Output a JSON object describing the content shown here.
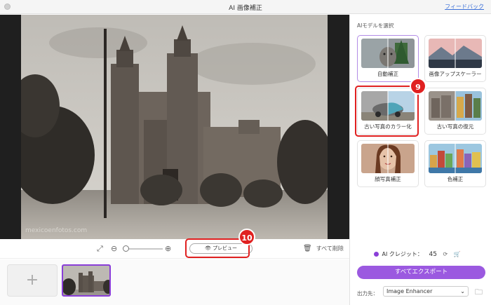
{
  "window": {
    "title": "AI 画像補正",
    "feedback_link": "フィードバック"
  },
  "toolbar": {
    "preview_label": "プレビュー",
    "delete_all_label": "すべて削除",
    "icons": [
      "compare-icon",
      "zoom-out-icon",
      "zoom-in-icon",
      "eye-icon",
      "trash-icon"
    ]
  },
  "photo": {
    "watermark": "mexicoenfotos.com"
  },
  "annotations": {
    "badge_9": "9",
    "badge_10": "10"
  },
  "sidebar": {
    "section_label": "AIモデルを選択",
    "models": [
      {
        "label": "自動補正",
        "selected": true
      },
      {
        "label": "画像アップスケーラー",
        "selected": false
      },
      {
        "label": "古い写真のカラー化",
        "selected": false
      },
      {
        "label": "古い写真の復元",
        "selected": false
      },
      {
        "label": "顔写真補正",
        "selected": false
      },
      {
        "label": "色補正",
        "selected": false
      }
    ],
    "credits_label": "AI クレジット：",
    "credits_value": "45",
    "export_label": "すべてエクスポート",
    "output_label": "出力先：",
    "output_value": "Image Enhancer"
  },
  "colors": {
    "accent": "#9b59e0",
    "highlight": "#e02020",
    "link": "#3a6fd8"
  }
}
